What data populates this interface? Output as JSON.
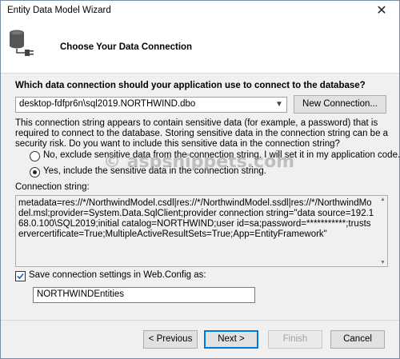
{
  "window": {
    "title": "Entity Data Model Wizard",
    "close_glyph": "✕"
  },
  "header": {
    "heading": "Choose Your Data Connection",
    "icon": "database-plug-icon"
  },
  "connection": {
    "question": "Which data connection should your application use to connect to the database?",
    "selected": "desktop-fdfpr6n\\sql2019.NORTHWIND.dbo",
    "new_connection_label": "New Connection..."
  },
  "warning": "This connection string appears to contain sensitive data (for example, a password) that is required to connect to the database. Storing sensitive data in the connection string can be a security risk. Do you want to include this sensitive data in the connection string?",
  "radios": [
    {
      "label": "No, exclude sensitive data from the connection string. I will set it in my application code.",
      "selected": false
    },
    {
      "label": "Yes, include the sensitive data in the connection string.",
      "selected": true
    }
  ],
  "connection_string": {
    "label": "Connection string:",
    "value": "metadata=res://*/NorthwindModel.csdl|res://*/NorthwindModel.ssdl|res://*/NorthwindModel.msl;provider=System.Data.SqlClient;provider connection string=\"data source=192.168.0.100\\SQL2019;initial catalog=NORTHWIND;user id=sa;password=***********;trustservercertificate=True;MultipleActiveResultSets=True;App=EntityFramework\""
  },
  "save_settings": {
    "label": "Save connection settings in Web.Config as:",
    "checked": true,
    "value": "NORTHWINDEntities"
  },
  "watermark": "© aspsnippets.com",
  "buttons": {
    "previous": "< Previous",
    "next": "Next >",
    "finish": "Finish",
    "cancel": "Cancel"
  },
  "colors": {
    "accent": "#0078d7",
    "check": "#1e5fb4"
  }
}
